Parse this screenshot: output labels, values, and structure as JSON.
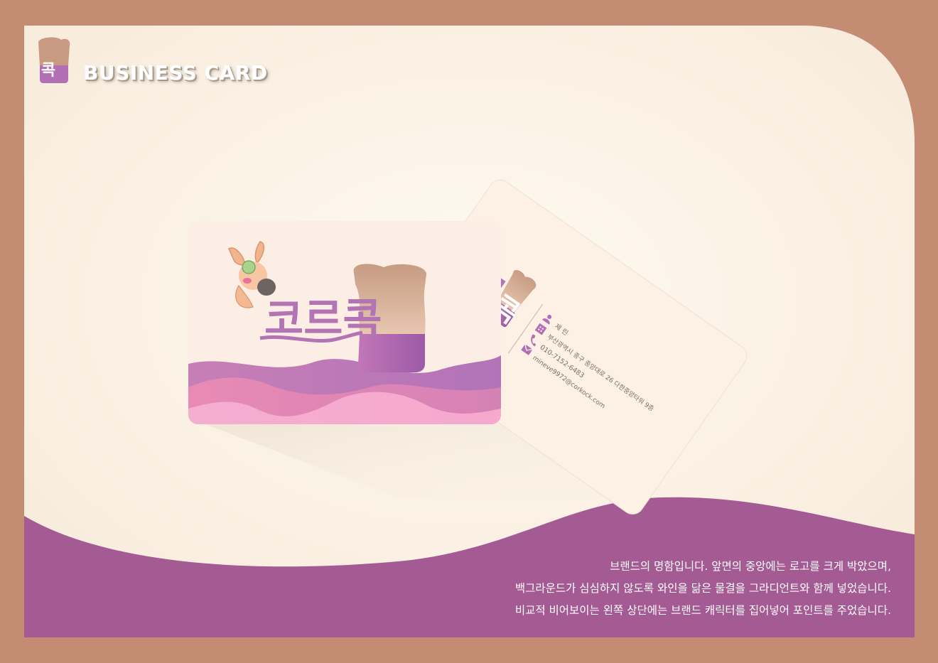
{
  "header": {
    "title": "BUSINESS CARD"
  },
  "front_card": {
    "logo_text": "코르콕"
  },
  "back_card": {
    "name": "제 린",
    "address": "부산광역시 중구 중앙대로 26 다한중앙타워 9층",
    "phone": "010-7152-6483",
    "email": "mineve9972@corkock.com"
  },
  "description": {
    "lines": [
      "브랜드의 명함입니다. 앞면의 중앙에는 로고를 크게 박았으며,",
      "백그라운드가 심심하지 않도록 와인을 닮은 물결을 그라디언트와 함께 넣었습니다.",
      "비교적 비어보이는 왼쪽 상단에는 브랜드 캐릭터를 집어넣어 포인트를 주었습니다."
    ]
  },
  "colors": {
    "background_frame": "#c48c72",
    "panel": "#fdf3e6",
    "wave_purple": "#a45a93",
    "cork_tan": "#c9a088",
    "logo_purple": "#a866b0",
    "wave_pink": "#f0a0c8"
  },
  "icons": {
    "person": "person-icon",
    "phone": "phone-icon",
    "address": "building-icon",
    "email": "mail-icon"
  }
}
